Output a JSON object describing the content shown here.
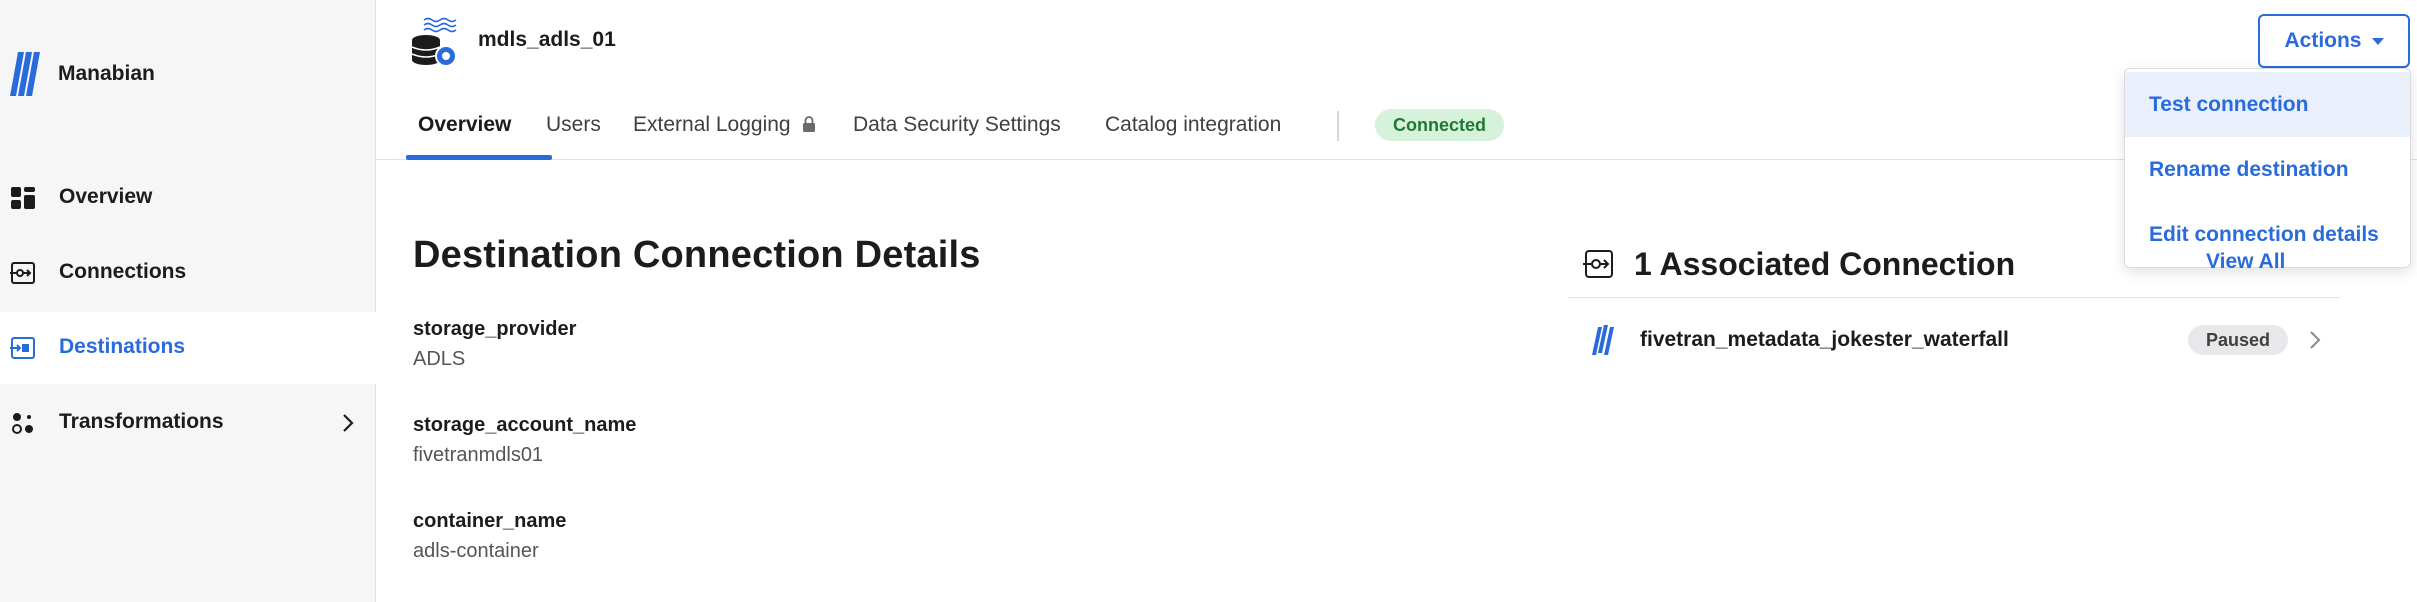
{
  "brand": {
    "name": "Manabian"
  },
  "sidebar": {
    "items": [
      {
        "label": "Overview",
        "icon": "dashboard-icon"
      },
      {
        "label": "Connections",
        "icon": "connections-icon"
      },
      {
        "label": "Destinations",
        "icon": "destination-icon",
        "active": true
      },
      {
        "label": "Transformations",
        "icon": "transformations-icon",
        "has_children": true
      }
    ]
  },
  "header": {
    "title": "mdls_adls_01",
    "icon": "database-gear-icon"
  },
  "tabs": [
    {
      "label": "Overview",
      "active": true
    },
    {
      "label": "Users"
    },
    {
      "label": "External Logging",
      "locked": true
    },
    {
      "label": "Data Security Settings"
    },
    {
      "label": "Catalog integration"
    }
  ],
  "status": {
    "label": "Connected",
    "color": "#1f7a32"
  },
  "actions": {
    "label": "Actions",
    "menu": [
      {
        "label": "Test connection"
      },
      {
        "label": "Rename destination"
      },
      {
        "label": "Edit connection details"
      }
    ]
  },
  "details": {
    "title": "Destination Connection Details",
    "fields": [
      {
        "label": "storage_provider",
        "value": "ADLS"
      },
      {
        "label": "storage_account_name",
        "value": "fivetranmdls01"
      },
      {
        "label": "container_name",
        "value": "adls-container"
      }
    ]
  },
  "associated": {
    "title": "1 Associated Connection",
    "view_all": "View All",
    "connections": [
      {
        "name": "fivetran_metadata_jokester_waterfall",
        "status": "Paused"
      }
    ]
  },
  "colors": {
    "accent": "#2a6bdc",
    "connected_bg": "#d6f2da",
    "paused_bg": "#e8e8ea"
  }
}
